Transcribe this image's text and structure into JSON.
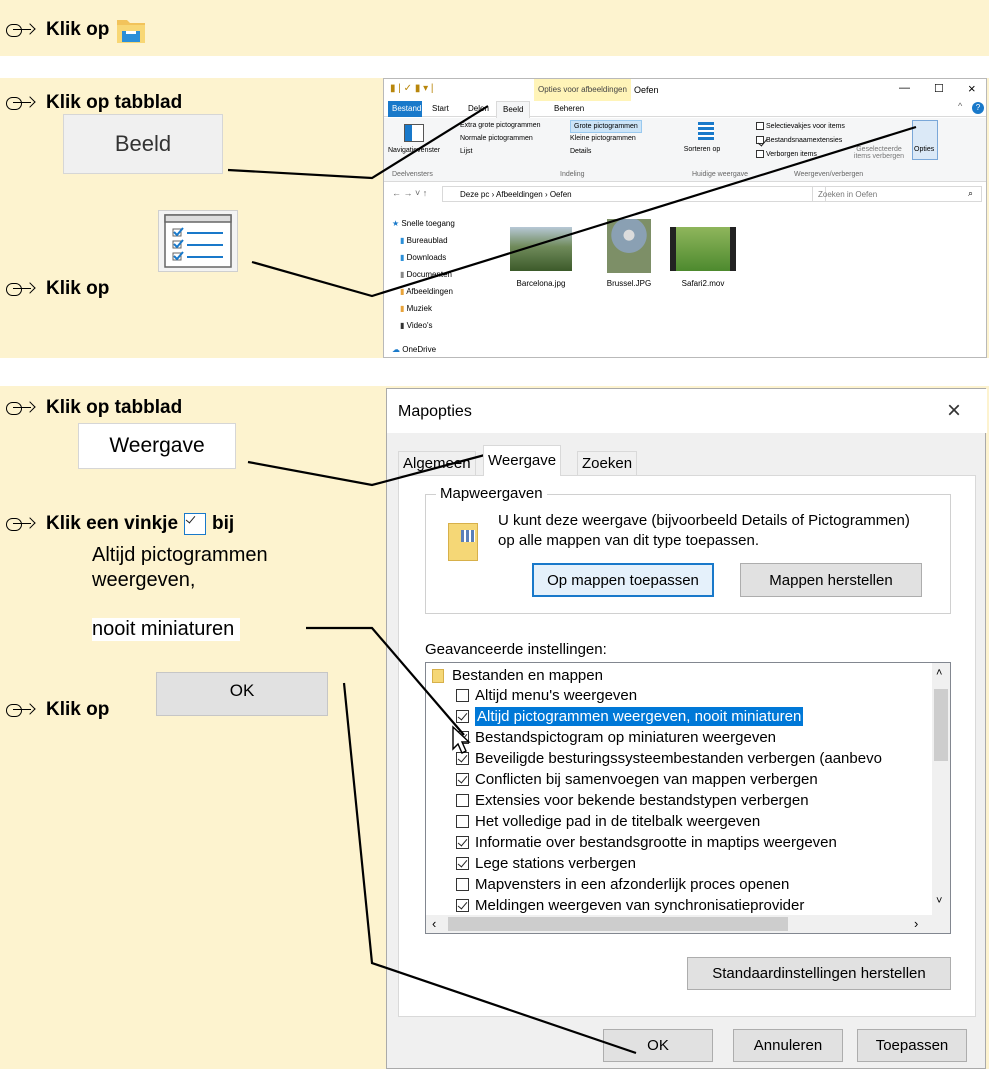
{
  "steps": {
    "s1": "Klik op",
    "s2": "Klik op tabblad",
    "s2_tab": "Beeld",
    "s3": "Klik op",
    "s4": "Klik op tabblad",
    "s4_tab": "Weergave",
    "s5_a": "Klik een vinkje",
    "s5_b": "bij",
    "s5_opt1": "Altijd pictogrammen",
    "s5_opt2": "weergeven,",
    "s5_opt3": "nooit miniaturen",
    "s6": "Klik op",
    "s6_btn": "OK"
  },
  "explorer": {
    "context_tab": "Opties voor afbeeldingen",
    "title": "Oefen",
    "tabs": [
      "Bestand",
      "Start",
      "Delen",
      "Beeld",
      "Beheren"
    ],
    "layout": [
      "Extra grote pictogrammen",
      "Grote pictogrammen",
      "Normale pictogrammen",
      "Kleine pictogrammen",
      "Lijst",
      "Details"
    ],
    "nav_pane": "Navigatievenster",
    "group_deelvensters": "Deelvensters",
    "group_indeling": "Indeling",
    "sort": "Sorteren op",
    "group_huidige": "Huidige weergave",
    "checks": [
      {
        "label": "Selectievakjes voor items",
        "checked": false
      },
      {
        "label": "Bestandsnaamextensies",
        "checked": true
      },
      {
        "label": "Verborgen items",
        "checked": false
      }
    ],
    "hide_selected": "Geselecteerde items verbergen",
    "options": "Opties",
    "group_weergeven": "Weergeven/verbergen",
    "address": "Deze pc › Afbeeldingen › Oefen",
    "search": "Zoeken in Oefen",
    "nav_items": [
      "Snelle toegang",
      "Bureaublad",
      "Downloads",
      "Documenten",
      "Afbeeldingen",
      "Muziek",
      "Video's",
      "OneDrive"
    ],
    "files": [
      "Barcelona.jpg",
      "Brussel.JPG",
      "Safari2.mov"
    ]
  },
  "dialog": {
    "title": "Mapopties",
    "close": "×",
    "tabs": [
      "Algemeen",
      "Weergave",
      "Zoeken"
    ],
    "group_title": "Mapweergaven",
    "group_text": "U kunt deze weergave (bijvoorbeeld Details of Pictogrammen) op alle mappen van dit type toepassen.",
    "apply_folders": "Op mappen toepassen",
    "reset_folders": "Mappen herstellen",
    "advanced": "Geavanceerde instellingen:",
    "tree_root": "Bestanden en mappen",
    "settings": [
      {
        "label": "Altijd menu's weergeven",
        "checked": false
      },
      {
        "label": "Altijd pictogrammen weergeven, nooit miniaturen",
        "checked": true
      },
      {
        "label": "Bestandspictogram op miniaturen weergeven",
        "checked": true
      },
      {
        "label": "Beveiligde besturingssysteembestanden verbergen (aanbevo",
        "checked": true
      },
      {
        "label": "Conflicten bij samenvoegen van mappen verbergen",
        "checked": true
      },
      {
        "label": "Extensies voor bekende bestandstypen verbergen",
        "checked": false
      },
      {
        "label": "Het volledige pad in de titelbalk weergeven",
        "checked": false
      },
      {
        "label": "Informatie over bestandsgrootte in maptips weergeven",
        "checked": true
      },
      {
        "label": "Lege stations verbergen",
        "checked": true
      },
      {
        "label": "Mapvensters in een afzonderlijk proces openen",
        "checked": false
      },
      {
        "label": "Meldingen weergeven van synchronisatieprovider",
        "checked": true
      }
    ],
    "restore_defaults": "Standaardinstellingen herstellen",
    "ok": "OK",
    "cancel": "Annuleren",
    "apply": "Toepassen"
  },
  "colors": {
    "band": "#fdf3cf",
    "selection": "#0078d7",
    "accent": "#1979ca"
  }
}
